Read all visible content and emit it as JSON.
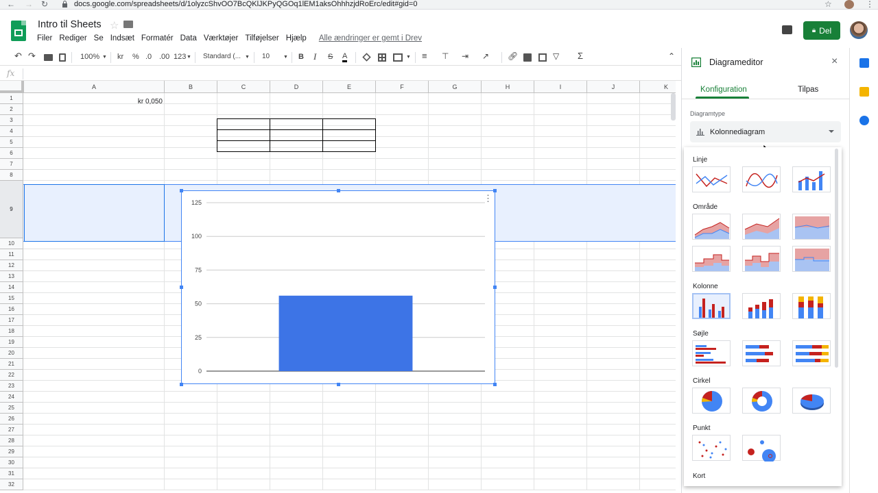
{
  "browser": {
    "url": "docs.google.com/spreadsheets/d/1olyzcShvOO7BcQKlJKPyQGOq1lEM1aksOhhhzjdRoErc/edit#gid=0"
  },
  "header": {
    "title": "Intro til Sheets",
    "menu": [
      "Filer",
      "Rediger",
      "Se",
      "Indsæt",
      "Formatér",
      "Data",
      "Værktøjer",
      "Tilføjelser",
      "Hjælp"
    ],
    "saved_status": "Alle ændringer er gemt i Drev",
    "share_label": "Del"
  },
  "toolbar": {
    "zoom": "100%",
    "currency": "kr",
    "percent": "%",
    "dec_decrease": ".0",
    "dec_increase": ".00",
    "format_more": "123",
    "font": "Standard (...",
    "font_size": "10",
    "bold": "B",
    "italic": "I",
    "strike": "S",
    "text_color": "A",
    "sum": "Σ"
  },
  "formula_bar": {
    "fx": "fx"
  },
  "sheet": {
    "columns": [
      "A",
      "B",
      "C",
      "D",
      "E",
      "F",
      "G",
      "H",
      "I",
      "J",
      "K"
    ],
    "rows": [
      "1",
      "2",
      "3",
      "4",
      "5",
      "6",
      "7",
      "8",
      "9",
      "10",
      "11",
      "12",
      "13",
      "14",
      "15",
      "16",
      "17",
      "18",
      "19",
      "20",
      "21",
      "22",
      "23",
      "24",
      "25",
      "26",
      "27",
      "28",
      "29",
      "30",
      "31",
      "32"
    ],
    "cell_a1": "kr 0,050"
  },
  "chart_data": {
    "type": "bar",
    "categories": [
      ""
    ],
    "values": [
      56
    ],
    "ylim": [
      0,
      125
    ],
    "yticks": [
      "0",
      "25",
      "50",
      "75",
      "100",
      "125"
    ],
    "bar_color": "#3d74e6",
    "grid": true
  },
  "editor": {
    "title": "Diagrameditor",
    "tab_config": "Konfiguration",
    "tab_custom": "Tilpas",
    "diagram_type_label": "Diagramtype",
    "diagram_type_value": "Kolonnediagram",
    "categories": [
      "Linje",
      "Område",
      "Kolonne",
      "Søjle",
      "Cirkel",
      "Punkt",
      "Kort"
    ]
  },
  "colors": {
    "accent": "#188038",
    "blue": "#4285f4",
    "red": "#c5221f",
    "yellow": "#f4b400"
  }
}
